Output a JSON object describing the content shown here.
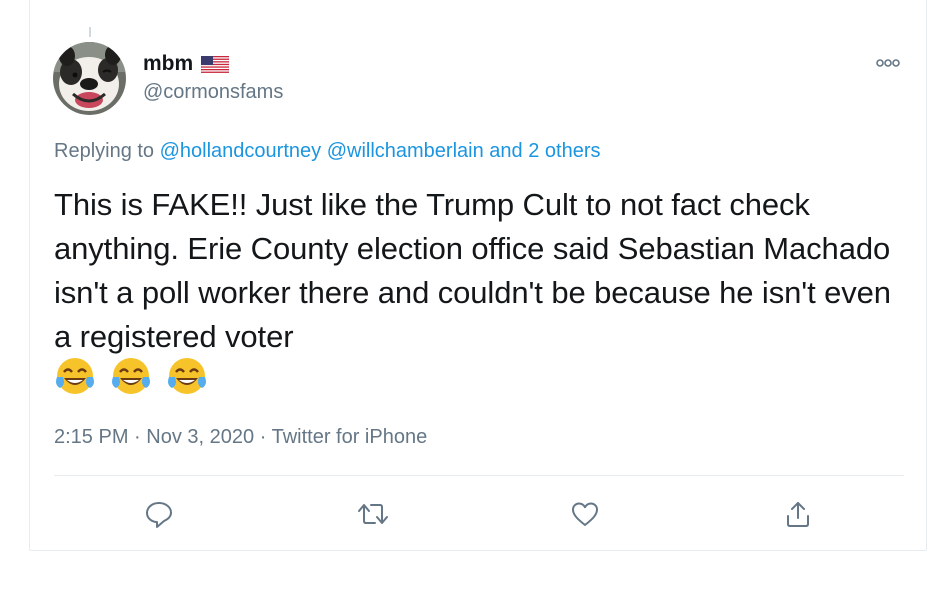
{
  "tweet": {
    "display_name": "mbm",
    "flag_emoji_icon": "us-flag-icon",
    "handle": "@cormonsfams",
    "replying_prefix": "Replying to",
    "replying_to": [
      "@hollandcourtney",
      "@willchamberlain"
    ],
    "replying_and_others": "and 2 others",
    "text": "This is FAKE!! Just like the Trump Cult to not fact check anything. Erie County election office said Sebastian Machado isn't a poll worker there and couldn't be because he isn't even a registered voter",
    "emojis": [
      "tears-of-joy-icon",
      "tears-of-joy-icon",
      "tears-of-joy-icon"
    ],
    "time": "2:15 PM",
    "separator": "·",
    "date": "Nov 3, 2020",
    "source": "Twitter for iPhone"
  },
  "actions": {
    "reply_icon": "reply-icon",
    "retweet_icon": "retweet-icon",
    "like_icon": "heart-icon",
    "share_icon": "share-icon"
  },
  "colors": {
    "link": "#1b95e0",
    "secondary_text": "#657786",
    "primary_text": "#14171a",
    "border": "#e6ecf0"
  }
}
